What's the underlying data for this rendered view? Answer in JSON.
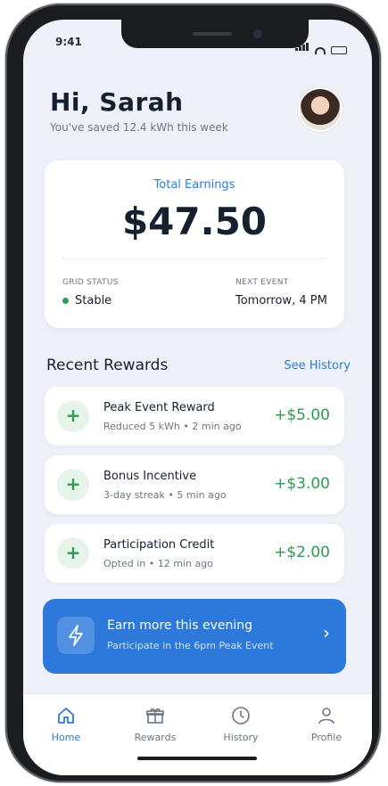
{
  "status_bar": {
    "time": "9:41"
  },
  "header": {
    "greeting": "Hi, Sarah",
    "subtitle": "You've saved 12.4 kWh this week"
  },
  "earnings": {
    "label": "Total Earnings",
    "value": "$47.50",
    "grid_status_label": "GRID STATUS",
    "grid_status_value": "Stable",
    "grid_status_color": "#2e9a55",
    "next_event_label": "NEXT EVENT",
    "next_event_value": "Tomorrow, 4 PM"
  },
  "rewards": {
    "title": "Recent Rewards",
    "see_history": "See History",
    "items": [
      {
        "icon": "plus-icon",
        "title": "Peak Event Reward",
        "subtitle": "Reduced 5 kWh • 2 min ago",
        "amount": "+$5.00"
      },
      {
        "icon": "plus-icon",
        "title": "Bonus Incentive",
        "subtitle": "3-day streak • 5 min ago",
        "amount": "+$3.00"
      },
      {
        "icon": "plus-icon",
        "title": "Participation Credit",
        "subtitle": "Opted in • 12 min ago",
        "amount": "+$2.00"
      }
    ]
  },
  "promo": {
    "icon": "lightning-icon",
    "title": "Earn more this evening",
    "subtitle": "Participate in the 6pm Peak Event",
    "color": "#2c78db"
  },
  "tabbar": {
    "tabs": [
      {
        "label": "Home",
        "icon": "home-icon",
        "active": true
      },
      {
        "label": "Rewards",
        "icon": "gift-icon",
        "active": false
      },
      {
        "label": "History",
        "icon": "clock-icon",
        "active": false
      },
      {
        "label": "Profile",
        "icon": "person-icon",
        "active": false
      }
    ]
  },
  "colors": {
    "accent": "#2c78db",
    "positive": "#2e9a55",
    "background": "#eef2f8"
  }
}
